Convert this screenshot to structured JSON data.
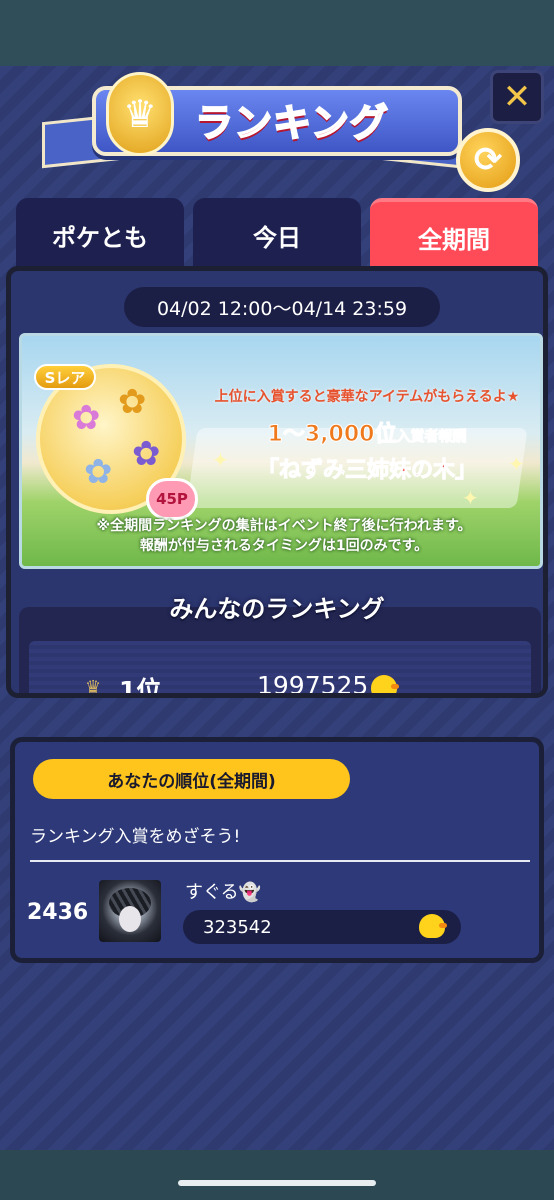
{
  "header": {
    "title": "ランキング",
    "crown_icon": "crown-icon",
    "close_icon": "close-icon",
    "refresh_icon": "refresh-icon"
  },
  "tabs": [
    {
      "label": "ポケとも",
      "active": false
    },
    {
      "label": "今日",
      "active": false
    },
    {
      "label": "全期間",
      "active": true
    }
  ],
  "ranking": {
    "period": "04/02 12:00〜04/14 23:59",
    "banner": {
      "rarity": "Sレア",
      "points": "45P",
      "line1": "上位に入賞すると豪華なアイテムがもらえるよ★",
      "line2_main": "1〜3,000位",
      "line2_sub": "入賞者報酬",
      "line3": "「ねずみ三姉妹の木」",
      "note_line1": "※全期間ランキングの集計はイベント終了後に行われます。",
      "note_line2": "報酬が付与されるタイミングは1回のみです。"
    },
    "section_title": "みんなのランキング",
    "rows": [
      {
        "rank": "1位",
        "score": "1997525"
      }
    ]
  },
  "my_rank": {
    "label": "あなたの順位(全期間)",
    "message": "ランキング入賞をめざそう!",
    "rank": "2436",
    "name": "すぐる👻",
    "score": "323542"
  },
  "colors": {
    "accent_red": "#ff4a58",
    "accent_yellow": "#ffc51c",
    "panel_navy": "#2d3978"
  }
}
